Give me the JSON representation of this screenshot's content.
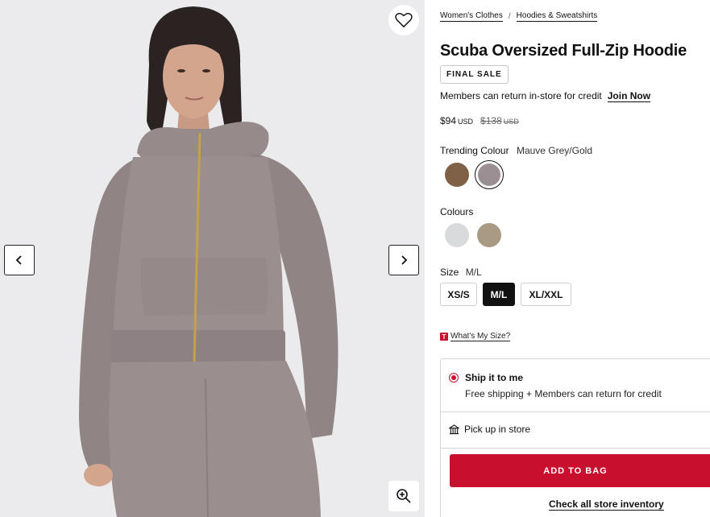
{
  "breadcrumb": [
    {
      "label": "Women's Clothes"
    },
    {
      "label": "Hoodies & Sweatshirts"
    }
  ],
  "breadcrumb_separator": "/",
  "product": {
    "title": "Scuba Oversized Full-Zip Hoodie",
    "badge": "FINAL SALE",
    "member_text": "Members can return in-store for credit",
    "join_label": "Join Now",
    "price": "$94",
    "currency": "USD",
    "original_price": "$138",
    "original_currency": "USD"
  },
  "trending_colour": {
    "label": "Trending Colour",
    "selected": "Mauve Grey/Gold",
    "swatches": [
      {
        "name": "brown",
        "color": "#7f6147",
        "selected": false
      },
      {
        "name": "mauve-grey",
        "color": "#9b8f94",
        "selected": true
      }
    ]
  },
  "colours": {
    "label": "Colours",
    "swatches": [
      {
        "name": "light-grey",
        "color": "#d9dadb"
      },
      {
        "name": "taupe",
        "color": "#a99a83"
      }
    ]
  },
  "size": {
    "label": "Size",
    "selected": "M/L",
    "options": [
      "XS/S",
      "M/L",
      "XL/XXL"
    ]
  },
  "size_guide": {
    "badge": "T",
    "label": "What's My Size?"
  },
  "fulfilment": {
    "ship_title": "Ship it to me",
    "ship_desc": "Free shipping + Members can return for credit",
    "pickup_label": "Pick up in store",
    "add_to_bag": "ADD TO BAG",
    "inventory_link": "Check all store inventory"
  },
  "colors": {
    "accent": "#c8102e",
    "text": "#111111",
    "border": "#d6d6d6"
  },
  "icons": [
    "heart-icon",
    "chevron-left-icon",
    "chevron-right-icon",
    "zoom-in-icon",
    "store-icon",
    "radio-selected-icon"
  ]
}
